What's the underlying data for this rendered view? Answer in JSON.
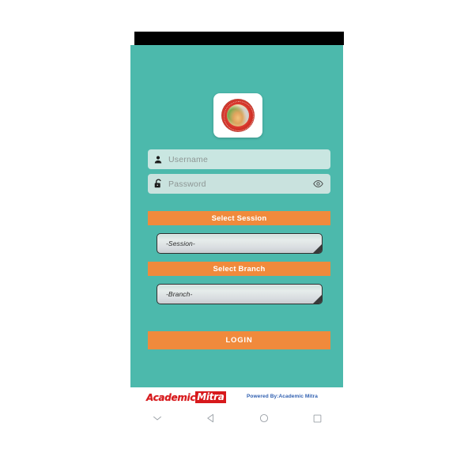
{
  "screen": {
    "background_color": "#4cb9ac",
    "accent_color": "#f08a3c",
    "brand_red": "#d7191c",
    "powered_blue": "#2f5fb0"
  },
  "logo": {
    "icon": "school-crest-emblem",
    "alt": "school crest"
  },
  "form": {
    "username": {
      "icon": "user-icon",
      "placeholder": "Username",
      "value": ""
    },
    "password": {
      "icon": "lock-icon",
      "placeholder": "Password",
      "value": "",
      "toggle_icon": "eye-icon"
    },
    "session": {
      "button_label": "Select Session",
      "selected": "-Session-",
      "options": [
        "-Session-"
      ]
    },
    "branch": {
      "button_label": "Select Branch",
      "selected": "-Branch-",
      "options": [
        "-Branch-"
      ]
    },
    "login_label": "LOGIN"
  },
  "footer": {
    "brand_part1": "Academic",
    "brand_part2": "Mitra",
    "powered_by": "Powered By:Academic Mitra"
  },
  "navbar": {
    "items": [
      {
        "name": "hide-keyboard-icon",
        "glyph": "chevron-down"
      },
      {
        "name": "back-icon",
        "glyph": "triangle-left"
      },
      {
        "name": "home-icon",
        "glyph": "circle"
      },
      {
        "name": "recents-icon",
        "glyph": "square"
      }
    ]
  }
}
